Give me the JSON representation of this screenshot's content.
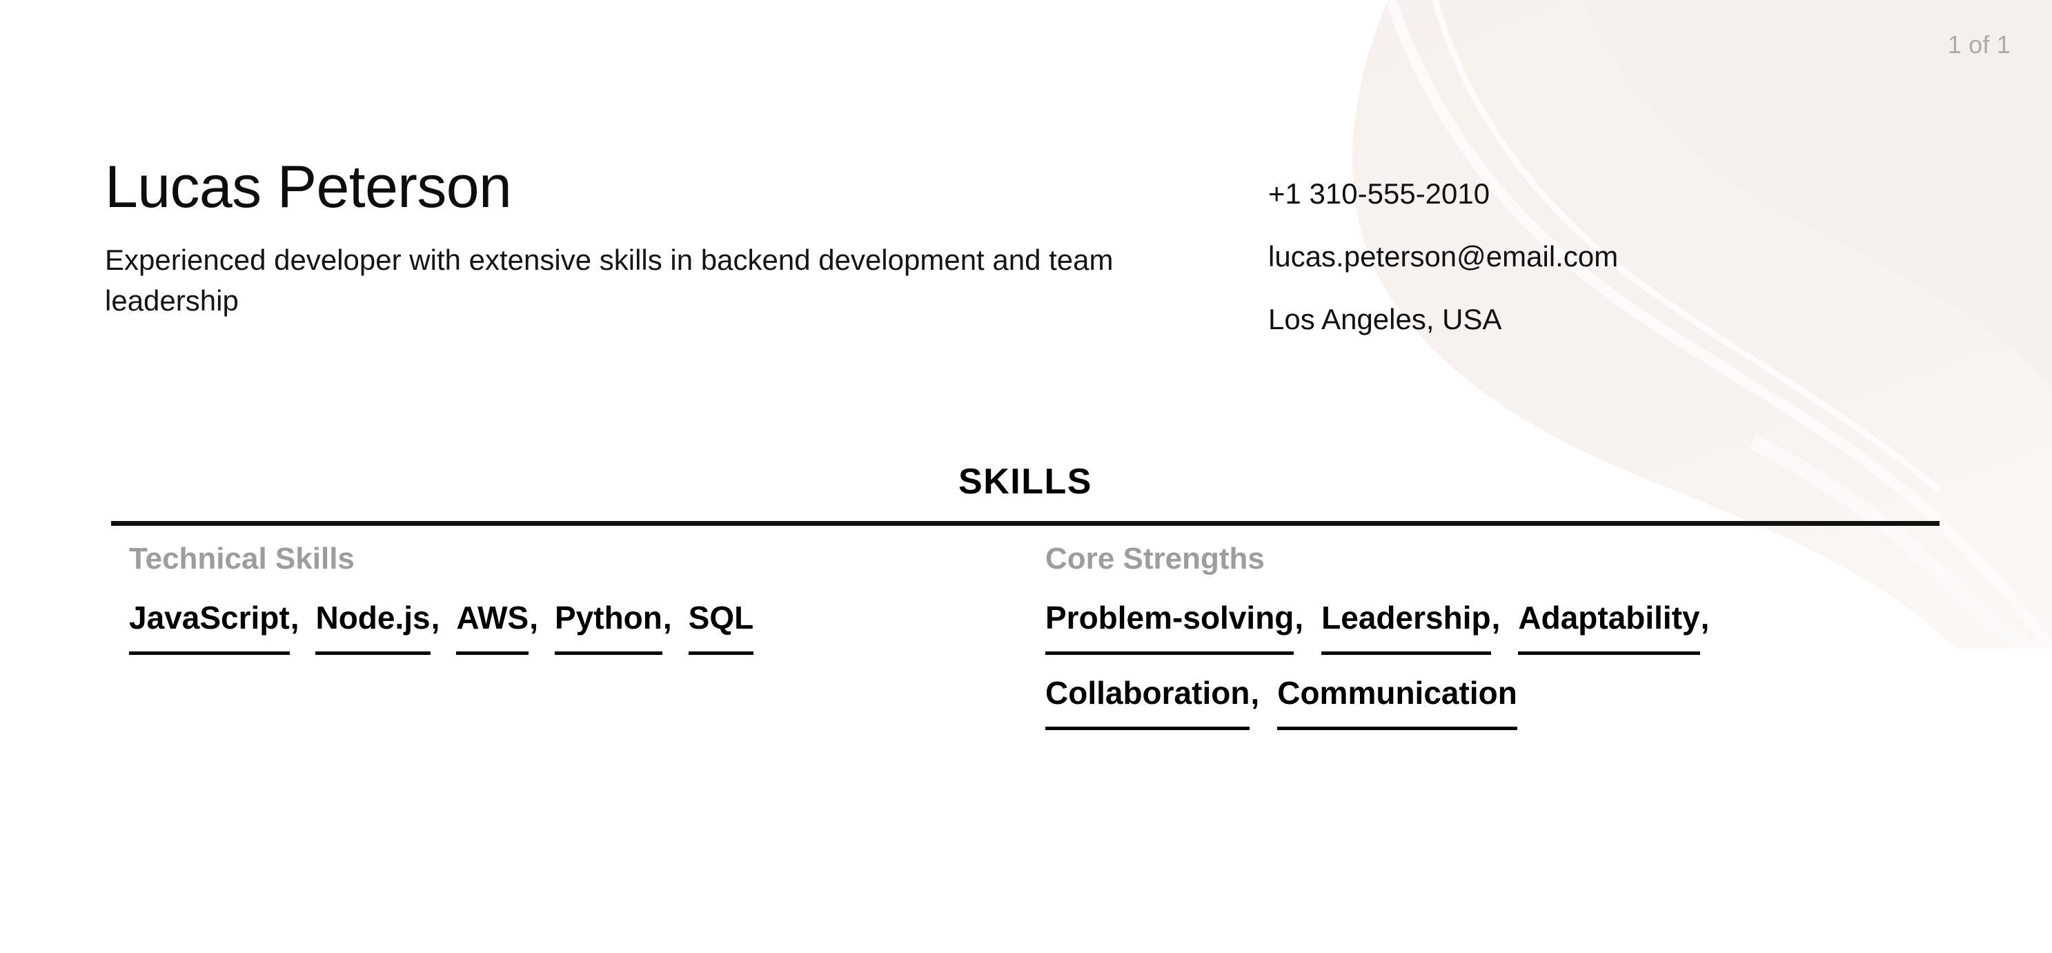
{
  "document": {
    "page_counter": "1 of 1",
    "accent_colors": {
      "text": "#111111",
      "muted_label": "#9d9d9d",
      "page_counter": "#b0aaa6",
      "decor_blob": "#f6f1ee",
      "rule": "#111111"
    }
  },
  "header": {
    "name": "Lucas Peterson",
    "summary": "Experienced developer with extensive skills in backend development and team leadership",
    "contact": [
      {
        "type": "phone",
        "value": "+1 310-555-2010"
      },
      {
        "type": "email",
        "value": "lucas.peterson@email.com"
      },
      {
        "type": "location",
        "value": "Los Angeles, USA"
      }
    ]
  },
  "skills_section": {
    "title": "SKILLS",
    "groups": [
      {
        "label": "Technical Skills",
        "items": [
          {
            "name": "JavaScript",
            "sep": ","
          },
          {
            "name": "Node.js",
            "sep": ","
          },
          {
            "name": "AWS",
            "sep": ","
          },
          {
            "name": "Python",
            "sep": ","
          },
          {
            "name": "SQL",
            "sep": ""
          }
        ]
      },
      {
        "label": "Core Strengths",
        "items": [
          {
            "name": "Problem-solving",
            "sep": ","
          },
          {
            "name": "Leadership",
            "sep": ","
          },
          {
            "name": "Adaptability",
            "sep": ","
          },
          {
            "name": "Collaboration",
            "sep": ","
          },
          {
            "name": "Communication",
            "sep": ""
          }
        ]
      }
    ]
  }
}
